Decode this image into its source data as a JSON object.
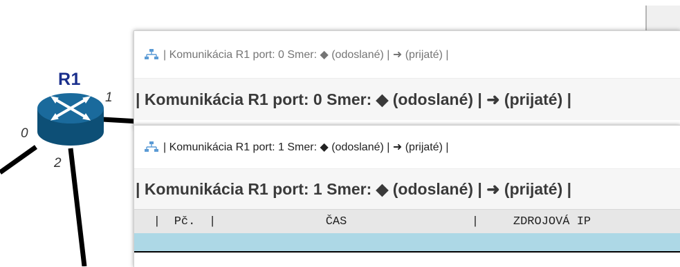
{
  "topology": {
    "router_name": "R1",
    "port_labels": [
      "0",
      "1",
      "2"
    ]
  },
  "windows": [
    {
      "title": "| Komunikácia R1 port: 0 Smer: ◆ (odoslané) | ➜ (prijaté)  |",
      "heading": "| Komunikácia R1 port: 0 Smer: ◆ (odoslané) | ➜ (prijaté)  |"
    },
    {
      "title": "| Komunikácia R1 port: 1 Smer: ◆ (odoslané) | ➜ (prijaté)  |",
      "heading": "| Komunikácia R1 port: 1 Smer: ◆ (odoslané) | ➜ (prijaté)  |",
      "table": {
        "columns": [
          "Pč.",
          "ČAS",
          "ZDROJOVÁ IP"
        ],
        "separator": "|"
      }
    }
  ],
  "colors": {
    "router_blue": "#1a6a9c",
    "router_label": "#1a2f8c",
    "selected_row": "#add8e6",
    "title_icon": "#5b9bd5"
  },
  "icons": {
    "title_icon": "network-icon"
  }
}
